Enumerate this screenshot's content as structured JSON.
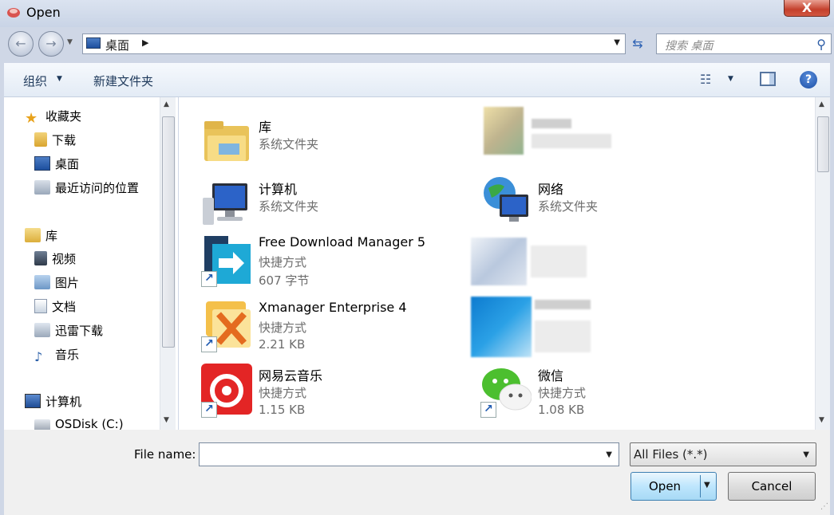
{
  "window": {
    "title": "Open",
    "close_label": "X"
  },
  "address": {
    "location": "桌面",
    "search_placeholder": "搜索 桌面"
  },
  "toolbar": {
    "organize_label": "组织",
    "new_folder_label": "新建文件夹"
  },
  "nav": {
    "items": [
      {
        "label": "收藏夹",
        "icon": "star-icon"
      },
      {
        "label": "下载",
        "icon": "download-folder-icon"
      },
      {
        "label": "桌面",
        "icon": "desktop-icon"
      },
      {
        "label": "最近访问的位置",
        "icon": "recent-places-icon"
      },
      {
        "label": "库",
        "icon": "library-icon"
      },
      {
        "label": "视频",
        "icon": "video-library-icon"
      },
      {
        "label": "图片",
        "icon": "pictures-library-icon"
      },
      {
        "label": "文档",
        "icon": "documents-library-icon"
      },
      {
        "label": "迅雷下载",
        "icon": "thunder-download-icon"
      },
      {
        "label": "音乐",
        "icon": "music-library-icon"
      },
      {
        "label": "计算机",
        "icon": "computer-icon"
      },
      {
        "label": "OSDisk (C:)",
        "icon": "disk-icon"
      }
    ]
  },
  "content": {
    "items": [
      {
        "name": "库",
        "type": "系统文件夹",
        "size": "",
        "icon": "library-folder-icon"
      },
      {
        "name": "计算机",
        "type": "系统文件夹",
        "size": "",
        "icon": "computer-icon"
      },
      {
        "name": "网络",
        "type": "系统文件夹",
        "size": "",
        "icon": "network-icon"
      },
      {
        "name": "Free Download Manager 5",
        "type": "快捷方式",
        "size": "607 字节",
        "icon": "fdm-icon"
      },
      {
        "name": "Xmanager Enterprise 4",
        "type": "快捷方式",
        "size": "2.21 KB",
        "icon": "xmanager-icon"
      },
      {
        "name": "网易云音乐",
        "type": "快捷方式",
        "size": "1.15 KB",
        "icon": "netease-music-icon"
      },
      {
        "name": "微信",
        "type": "快捷方式",
        "size": "1.08 KB",
        "icon": "wechat-icon"
      }
    ]
  },
  "bottom": {
    "file_name_label": "File name:",
    "file_name_value": "",
    "filter_value": "All Files (*.*)",
    "open_label": "Open",
    "cancel_label": "Cancel"
  },
  "colors": {
    "accent": "#3c7fb1",
    "window_bg": "#f0f0f0",
    "toolbar_text": "#1e395b"
  }
}
